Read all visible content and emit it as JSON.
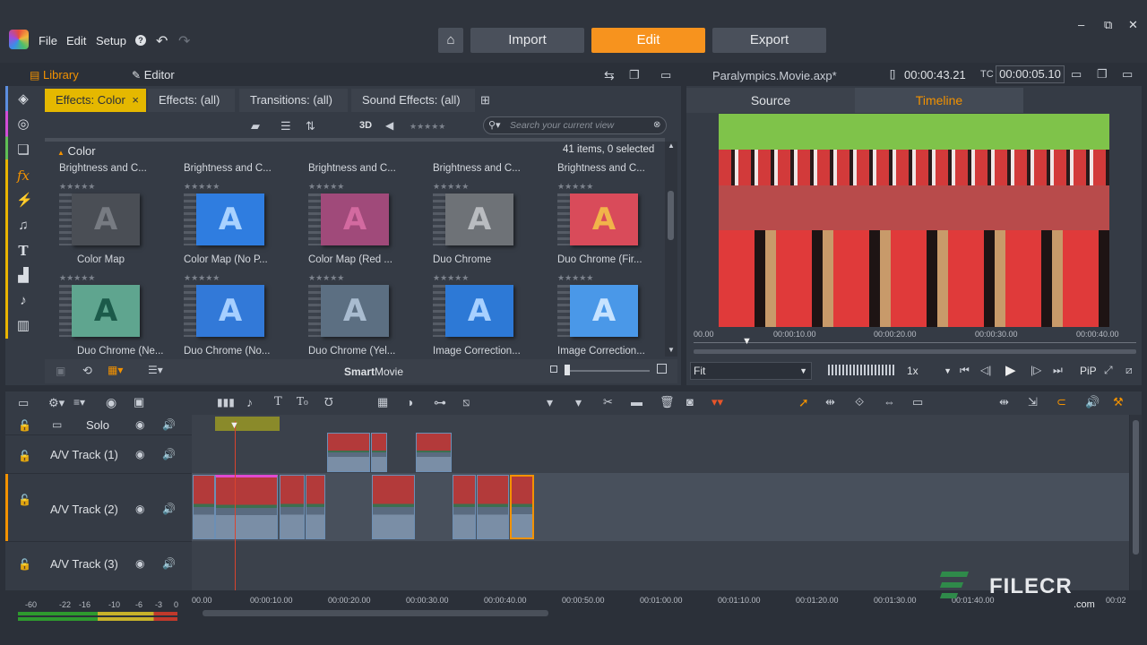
{
  "menu": {
    "file": "File",
    "edit": "Edit",
    "setup": "Setup",
    "help": "?"
  },
  "modes": {
    "import": "Import",
    "edit": "Edit",
    "export": "Export"
  },
  "window_controls": {
    "min": "–",
    "restore": "⧉",
    "close": "✕"
  },
  "left_panel": {
    "tabs": {
      "library": "Library",
      "editor": "Editor"
    },
    "effect_tabs": [
      "Effects: Color",
      "Effects: (all)",
      "Transitions: (all)",
      "Sound Effects: (all)"
    ],
    "effect_tab_close": "×",
    "toolbar": {
      "threed": "3D",
      "search_placeholder": "Search your current view"
    },
    "section_title": "Color",
    "status": "41 items, 0 selected",
    "row1_labels": [
      "Brightness and C...",
      "Brightness and C...",
      "Brightness and C...",
      "Brightness and C...",
      "Brightness and C..."
    ],
    "row2_labels": [
      "Color Map",
      "Color Map (No P...",
      "Color Map (Red ...",
      "Duo Chrome",
      "Duo Chrome (Fir..."
    ],
    "row3_labels": [
      "Duo Chrome (Ne...",
      "Duo Chrome (No...",
      "Duo Chrome (Yel...",
      "Image Correction...",
      "Image Correction..."
    ],
    "thumb_letter": "A",
    "row2_colors": [
      {
        "bg": "#4a4e55",
        "fg": "#777b82"
      },
      {
        "bg": "#2f7de0",
        "fg": "#a9d2ff"
      },
      {
        "bg": "#a04a7a",
        "fg": "#d36aa0"
      },
      {
        "bg": "#6e7277",
        "fg": "#b9bcc0"
      },
      {
        "bg": "#d94b5a",
        "fg": "#f1b44a"
      }
    ],
    "row3_colors": [
      {
        "bg": "#5fa58f",
        "fg": "#1b5a4a"
      },
      {
        "bg": "#3279d8",
        "fg": "#a6cfff"
      },
      {
        "bg": "#5c6f82",
        "fg": "#a9bcd0"
      },
      {
        "bg": "#2d79d6",
        "fg": "#a7d0ff"
      },
      {
        "bg": "#4a98e8",
        "fg": "#c7e3ff"
      }
    ],
    "stars": "★★★★★",
    "footer": {
      "brand_bold": "Smart",
      "brand_rest": "Movie"
    }
  },
  "player": {
    "filename": "Paralympics.Movie.axp*",
    "timecode_label": "[]",
    "timecode": "00:00:43.21",
    "tc_label": "TC",
    "tc_value": "00:00:05.10",
    "tabs": {
      "source": "Source",
      "timeline": "Timeline"
    },
    "ruler": [
      "00.00",
      "00:00:10.00",
      "00:00:20.00",
      "00:00:30.00",
      "00:00:40.00"
    ],
    "fit": "Fit",
    "speed": "1x",
    "pip": "PiP"
  },
  "timeline": {
    "tracks": [
      {
        "name": "Solo"
      },
      {
        "name": "A/V Track (1)"
      },
      {
        "name": "A/V Track (2)"
      },
      {
        "name": "A/V Track (3)"
      }
    ],
    "ruler": [
      "00.00",
      "00:00:10.00",
      "00:00:20.00",
      "00:00:30.00",
      "00:00:40.00",
      "00:00:50.00",
      "00:01:00.00",
      "00:01:10.00",
      "00:01:20.00",
      "00:01:30.00",
      "00:01:40.00",
      "00:02"
    ],
    "meter": [
      "-60",
      "-22",
      "-16",
      "-10",
      "-6",
      "-3",
      "0"
    ]
  },
  "watermark": {
    "text": "FILECR",
    "sub": ".com"
  },
  "colors": {
    "accent": "#f39200",
    "edit_button": "#f7931e",
    "effects_tab": "#e5b800",
    "timeline_tab": "#f39200"
  }
}
